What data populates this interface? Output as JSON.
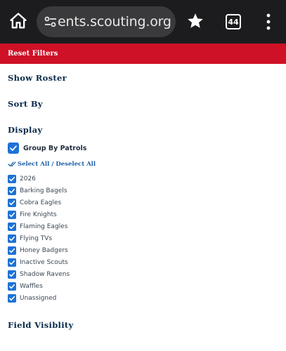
{
  "browser": {
    "url_text": "ents.scouting.org",
    "tab_count": "44",
    "icons": [
      "home-icon",
      "tune-icon",
      "star-icon",
      "tabs-icon",
      "more-vert-icon"
    ]
  },
  "toolbar": {
    "reset_label": "Reset Filters"
  },
  "sections": {
    "show_roster": "Show Roster",
    "sort_by": "Sort By",
    "display": "Display",
    "field_visibility": "Field Visiblity"
  },
  "display": {
    "group_by_label": "Group By Patrols",
    "group_by_checked": true,
    "select_all": "Select All",
    "separator": "/",
    "deselect_all": "Deselect All",
    "patrols": [
      {
        "label": "2026",
        "checked": true
      },
      {
        "label": "Barking Bagels",
        "checked": true
      },
      {
        "label": "Cobra Eagles",
        "checked": true
      },
      {
        "label": "Fire Knights",
        "checked": true
      },
      {
        "label": "Flaming Eagles",
        "checked": true
      },
      {
        "label": "Flying TVs",
        "checked": true
      },
      {
        "label": "Honey Badgers",
        "checked": true
      },
      {
        "label": "Inactive Scouts",
        "checked": true
      },
      {
        "label": "Shadow Ravens",
        "checked": true
      },
      {
        "label": "Waffles",
        "checked": true
      },
      {
        "label": "Unassigned",
        "checked": true
      }
    ]
  },
  "colors": {
    "brand_red": "#ce1126",
    "checkbox_blue": "#1e72d6",
    "heading_navy": "#0a2a4a",
    "link_blue": "#1e5fa8"
  }
}
